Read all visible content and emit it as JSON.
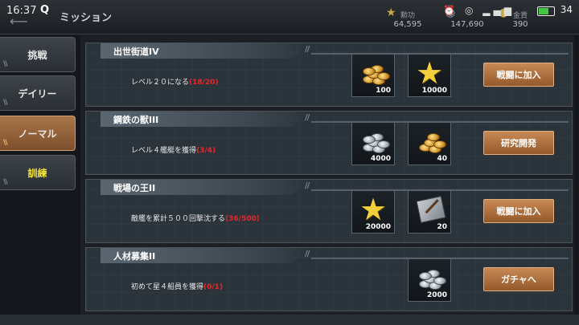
{
  "status_bar": {
    "time": "16:37",
    "battery": "34",
    "app_icon": "Q"
  },
  "header": {
    "title": "ミッション",
    "back_icon": "back-arrow-icon",
    "resources": [
      {
        "icon": "star-medal-icon",
        "label": "勲功",
        "value": "64,595"
      },
      {
        "icon": "fuel-icon",
        "label": "",
        "value": "147,690"
      },
      {
        "icon": "coin-icon",
        "label": "金貨",
        "value": "390"
      }
    ]
  },
  "sidebar": {
    "tabs": [
      {
        "label": "挑戦",
        "active": false,
        "highlight": false
      },
      {
        "label": "デイリー",
        "active": false,
        "highlight": false
      },
      {
        "label": "ノーマル",
        "active": true,
        "highlight": false
      },
      {
        "label": "訓練",
        "active": false,
        "highlight": true
      }
    ]
  },
  "missions": [
    {
      "title": "出世街道IV",
      "desc": "レベル２０になる",
      "progress": "(18/20)",
      "rewards": [
        {
          "type": "gold-coins",
          "qty": "100"
        },
        {
          "type": "star",
          "qty": "10000"
        }
      ],
      "action": "戦闘に加入"
    },
    {
      "title": "鋼鉄の獣III",
      "desc": "レベル４艦艇を獲得",
      "progress": "(3/4)",
      "rewards": [
        {
          "type": "silver-coins",
          "qty": "4000"
        },
        {
          "type": "gold-coins",
          "qty": "40"
        }
      ],
      "action": "研究開発"
    },
    {
      "title": "戦場の王II",
      "desc": "敵艦を累計５００回撃沈する",
      "progress": "(36/500)",
      "rewards": [
        {
          "type": "star",
          "qty": "20000"
        },
        {
          "type": "blueprint",
          "qty": "20"
        }
      ],
      "action": "戦闘に加入"
    },
    {
      "title": "人材募集II",
      "desc": "初めて星４船員を獲得",
      "progress": "(0/1)",
      "rewards": [
        {
          "type": "silver-coins",
          "qty": "2000"
        }
      ],
      "action": "ガチャへ"
    }
  ],
  "colors": {
    "accent": "#b07a4a",
    "progress": "#e8262a",
    "highlight_tab": "#f3e23a"
  }
}
